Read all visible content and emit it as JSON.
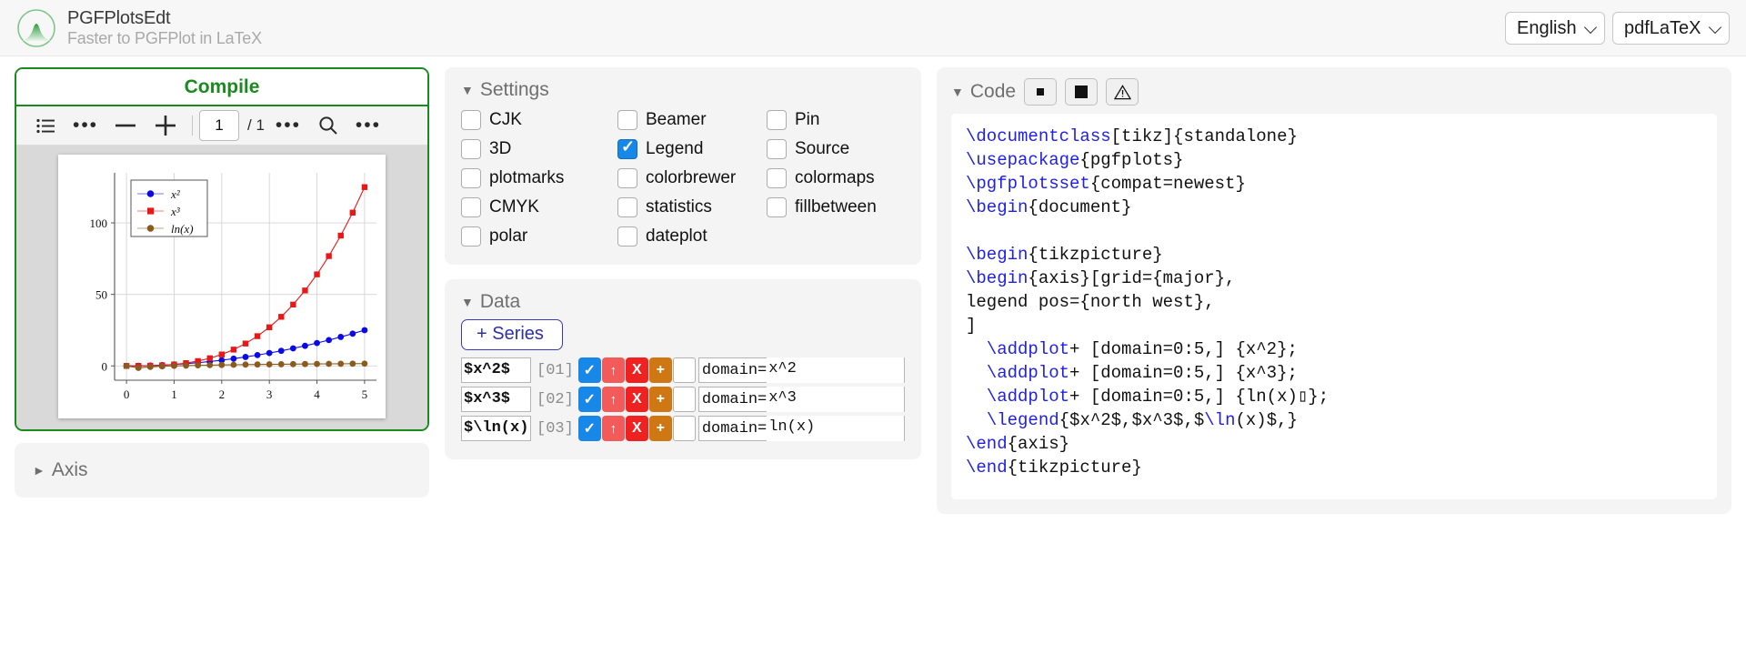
{
  "header": {
    "app_title": "PGFPlotsEdt",
    "subtitle": "Faster to PGFPlot in LaTeX",
    "logo_icon": "green-mountain-logo-icon",
    "language_select": {
      "value": "English",
      "options": [
        "English"
      ]
    },
    "engine_select": {
      "value": "pdfLaTeX",
      "options": [
        "pdfLaTeX"
      ]
    }
  },
  "preview": {
    "compile_label": "Compile",
    "toolbar": {
      "sidebar_icon": "list-sidebar-icon",
      "more_left_icon": "ellipsis-icon",
      "zoom_out_icon": "minus-icon",
      "zoom_in_icon": "plus-icon",
      "page_value": "1",
      "page_total": "/ 1",
      "more_mid_icon": "ellipsis-icon",
      "search_icon": "search-icon",
      "more_right_icon": "ellipsis-icon"
    },
    "axis_accordion": {
      "label": "Axis",
      "arrow": "►"
    }
  },
  "chart_data": {
    "type": "line",
    "title": "",
    "xlabel": "",
    "ylabel": "",
    "xlim": [
      -0.25,
      5.25
    ],
    "ylim": [
      -10,
      135
    ],
    "xticks": [
      0,
      1,
      2,
      3,
      4,
      5
    ],
    "yticks": [
      0,
      50,
      100
    ],
    "grid": true,
    "legend_position": "north west",
    "legend_entries": [
      "x²",
      "x³",
      "ln(x)"
    ],
    "x": [
      0,
      0.25,
      0.5,
      0.75,
      1,
      1.25,
      1.5,
      1.75,
      2,
      2.25,
      2.5,
      2.75,
      3,
      3.25,
      3.5,
      3.75,
      4,
      4.25,
      4.5,
      4.75,
      5
    ],
    "series": [
      {
        "name": "x^2",
        "color": "#0a0ae6",
        "mark": "circle",
        "values": [
          0,
          0.06,
          0.25,
          0.56,
          1,
          1.56,
          2.25,
          3.06,
          4,
          5.06,
          6.25,
          7.56,
          9,
          10.56,
          12.25,
          14.06,
          16,
          18.06,
          20.25,
          22.56,
          25
        ]
      },
      {
        "name": "x^3",
        "color": "#e81818",
        "mark": "square",
        "values": [
          0,
          0.02,
          0.13,
          0.42,
          1,
          1.95,
          3.38,
          5.36,
          8,
          11.39,
          15.63,
          20.8,
          27,
          34.33,
          42.88,
          52.73,
          64,
          76.77,
          91.13,
          107.17,
          125
        ]
      },
      {
        "name": "ln(x)",
        "color": "#8a5a1e",
        "mark": "circle",
        "values": [
          0,
          -1.39,
          -0.69,
          -0.29,
          0,
          0.22,
          0.41,
          0.56,
          0.69,
          0.81,
          0.92,
          1.01,
          1.1,
          1.18,
          1.25,
          1.32,
          1.39,
          1.45,
          1.5,
          1.56,
          1.61
        ]
      }
    ]
  },
  "settings": {
    "title": "Settings",
    "arrow": "▼",
    "columns": [
      [
        {
          "label": "CJK",
          "checked": false
        },
        {
          "label": "3D",
          "checked": false
        },
        {
          "label": "plotmarks",
          "checked": false
        },
        {
          "label": "CMYK",
          "checked": false
        },
        {
          "label": "polar",
          "checked": false
        }
      ],
      [
        {
          "label": "Beamer",
          "checked": false
        },
        {
          "label": "Legend",
          "checked": true
        },
        {
          "label": "colorbrewer",
          "checked": false
        },
        {
          "label": "statistics",
          "checked": false
        },
        {
          "label": "dateplot",
          "checked": false
        }
      ],
      [
        {
          "label": "Pin",
          "checked": false
        },
        {
          "label": "Source",
          "checked": false
        },
        {
          "label": "colormaps",
          "checked": false
        },
        {
          "label": "fillbetween",
          "checked": false
        }
      ]
    ]
  },
  "data_panel": {
    "title": "Data",
    "arrow": "▼",
    "add_series_label": "+ Series",
    "domain_label": "domain=",
    "rows": [
      {
        "name": "$x^2$",
        "index": "[01]",
        "enabled_icon": "✓",
        "move_icon": "↑",
        "delete_icon": "X",
        "add_icon": "+",
        "domain_value": "x^2"
      },
      {
        "name": "$x^3$",
        "index": "[02]",
        "enabled_icon": "✓",
        "move_icon": "↑",
        "delete_icon": "X",
        "add_icon": "+",
        "domain_value": "x^3"
      },
      {
        "name": "$\\ln(x)",
        "index": "[03]",
        "enabled_icon": "✓",
        "move_icon": "↑",
        "delete_icon": "X",
        "add_icon": "+",
        "domain_value": "ln(x)"
      }
    ]
  },
  "code_panel": {
    "title": "Code",
    "arrow": "▼",
    "btn_small_icon": "small-square-icon",
    "btn_large_icon": "large-square-icon",
    "btn_warning_icon": "warning-triangle-icon",
    "source": "\\documentclass[tikz]{standalone}\n\\usepackage{pgfplots}\n\\pgfplotsset{compat=newest}\n\\begin{document}\n\n\\begin{tikzpicture}\n\\begin{axis}[grid={major},\nlegend pos={north west},\n]\n  \\addplot+ [domain=0:5,] {x^2};\n  \\addplot+ [domain=0:5,] {x^3};\n  \\addplot+ [domain=0:5,] {ln(x)▯};\n  \\legend{$x^2$,$x^3$,$\\ln(x)$,}\n\\end{axis}\n\\end{tikzpicture}\n\n\\end{document}"
  },
  "colors": {
    "accent_green": "#1a8a1f",
    "checkbox_blue": "#1787e8",
    "series_blue": "#0a0ae6",
    "series_red": "#e81818",
    "series_brown": "#8a5a1e"
  }
}
